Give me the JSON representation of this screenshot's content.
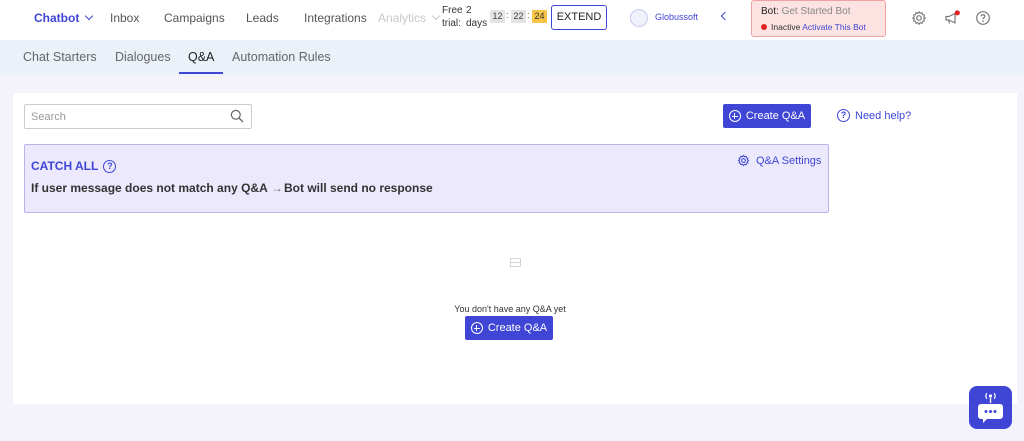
{
  "nav": {
    "items": [
      {
        "label": "Chatbot",
        "active": true
      },
      {
        "label": "Inbox"
      },
      {
        "label": "Campaigns"
      },
      {
        "label": "Leads"
      },
      {
        "label": "Integrations"
      },
      {
        "label": "Analytics",
        "disabled": true
      }
    ],
    "trial": {
      "line1_word": "Free",
      "line1_num": "2",
      "line2_word1": "trial:",
      "line2_word2": "days",
      "hours": "12",
      "minutes": "22",
      "seconds": "24",
      "separator": ":"
    },
    "extend_label": "EXTEND",
    "org_name": "Globussoft",
    "bot": {
      "prefix": "Bot:",
      "name": "Get Started Bot",
      "status": "Inactive",
      "activate_label": "Activate This Bot",
      "status_color": "#e02424"
    },
    "icons": [
      "gear-icon",
      "megaphone-icon",
      "help-icon"
    ]
  },
  "subnav": {
    "tabs": [
      {
        "label": "Chat Starters"
      },
      {
        "label": "Dialogues"
      },
      {
        "label": "Q&A",
        "active": true
      },
      {
        "label": "Automation Rules"
      }
    ]
  },
  "toolbar": {
    "search_placeholder": "Search",
    "create_label": "Create Q&A",
    "help_label": "Need help?"
  },
  "catch_all": {
    "title": "CATCH ALL",
    "settings_label": "Q&A Settings",
    "condition": "If user message does not match any Q&A",
    "arrow": "→",
    "response": "Bot will send no response"
  },
  "empty_state": {
    "message": "You don't have any Q&A yet",
    "create_label": "Create Q&A"
  },
  "colors": {
    "accent": "#3f46d6",
    "subnav_bg": "#eaf1f8",
    "content_bg": "#f4f3fb",
    "catch_bg": "#ebe9fb",
    "bot_box_bg": "#fde2e2",
    "timer_seconds_bg": "#f6c446"
  }
}
